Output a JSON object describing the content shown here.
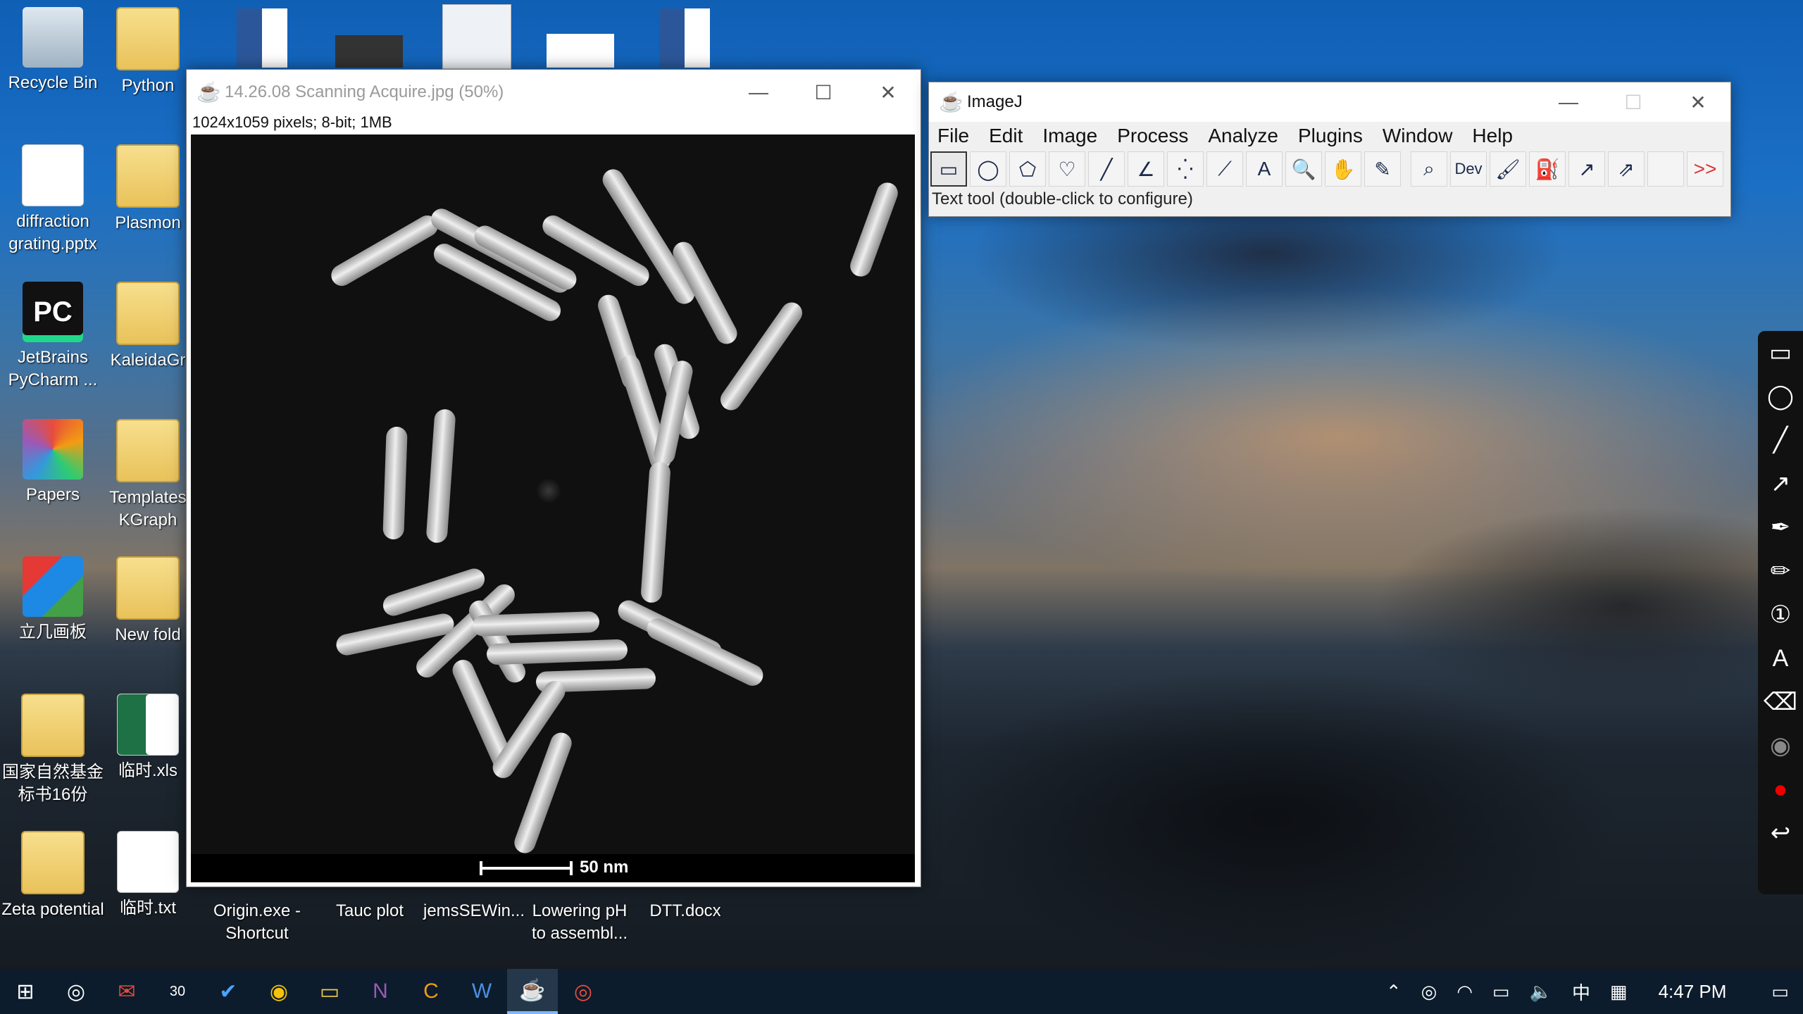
{
  "desktop": {
    "icons": [
      {
        "label": "Recycle Bin",
        "icon": "recycle-bin-icon"
      },
      {
        "label": "Python",
        "icon": "folder-icon"
      },
      {
        "label": "diffraction grating.pptx",
        "icon": "powerpoint-file-icon"
      },
      {
        "label": "Plasmon",
        "icon": "folder-icon"
      },
      {
        "label": "JetBrains PyCharm ...",
        "icon": "pycharm-icon"
      },
      {
        "label": "KaleidaGr",
        "icon": "folder-icon"
      },
      {
        "label": "Papers",
        "icon": "papers-app-icon"
      },
      {
        "label": "Templates KGraph",
        "icon": "folder-icon"
      },
      {
        "label": "立几画板",
        "icon": "cube-app-icon"
      },
      {
        "label": "New fold",
        "icon": "folder-icon"
      },
      {
        "label": "国家自然基金标书16份",
        "icon": "folder-icon"
      },
      {
        "label": "临时.xls",
        "icon": "excel-file-icon"
      },
      {
        "label": "Zeta potential",
        "icon": "folder-icon"
      },
      {
        "label": "临时.txt",
        "icon": "text-file-icon"
      },
      {
        "label": "Origin.exe - Shortcut",
        "icon": "shortcut-icon"
      },
      {
        "label": "Tauc plot",
        "icon": "folder-icon"
      },
      {
        "label": "jemsSEWin...",
        "icon": "folder-icon"
      },
      {
        "label": "Lowering pH to assembl...",
        "icon": "powerpoint-file-icon"
      },
      {
        "label": "DTT.docx",
        "icon": "word-file-icon"
      }
    ]
  },
  "image_window": {
    "title": "14.26.08 Scanning Acquire.jpg (50%)",
    "info": "1024x1059 pixels; 8-bit; 1MB",
    "scale_label": "50 nm"
  },
  "imagej": {
    "title": "ImageJ",
    "menu": [
      "File",
      "Edit",
      "Image",
      "Process",
      "Analyze",
      "Plugins",
      "Window",
      "Help"
    ],
    "tools": [
      "rectangle",
      "oval",
      "polygon",
      "freehand",
      "line",
      "angle",
      "multipoint",
      "wand",
      "text",
      "magnifier",
      "hand",
      "color-picker",
      "lookup",
      "Dev",
      "brush",
      "flood-fill",
      "arrow",
      "angle-arrow",
      "blank",
      "more"
    ],
    "dev_label": "Dev",
    "more_label": ">>",
    "status": "Text tool (double-click to configure)"
  },
  "taskbar": {
    "time": "4:47 PM",
    "ime": "中",
    "calendar_day": "30"
  }
}
